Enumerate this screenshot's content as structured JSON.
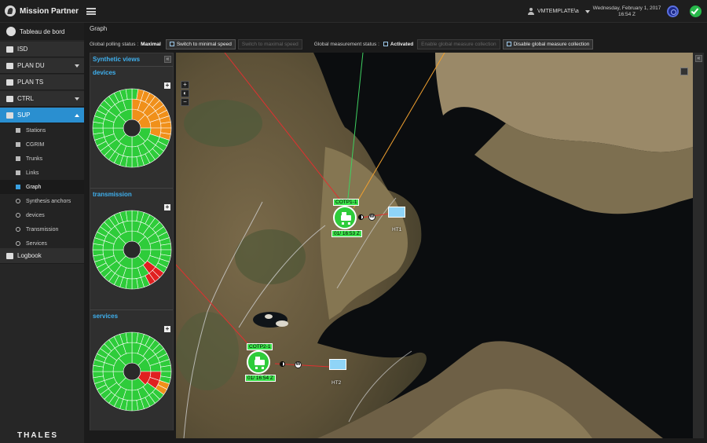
{
  "header": {
    "brand": "Mission Partner",
    "user": "VMTEMPLATE\\a",
    "date": "Wednesday, February 1, 2017",
    "time": "16:54 Z"
  },
  "sidebar": {
    "home": "Tableau de bord",
    "items": [
      {
        "label": "ISD"
      },
      {
        "label": "PLAN DU"
      },
      {
        "label": "PLAN TS"
      },
      {
        "label": "CTRL"
      },
      {
        "label": "SUP"
      }
    ],
    "sub_items": [
      {
        "label": "Stations"
      },
      {
        "label": "CGRIM"
      },
      {
        "label": "Trunks"
      },
      {
        "label": "Links"
      },
      {
        "label": "Graph"
      },
      {
        "label": "Synthesis anchors"
      },
      {
        "label": "devices"
      },
      {
        "label": "Transmission"
      },
      {
        "label": "Services"
      }
    ],
    "logbook": "Logbook",
    "footer": "THALES"
  },
  "breadcrumb": "Graph",
  "toolbar": {
    "polling_label": "Global polling status :",
    "polling_value": "Maximal",
    "btn_min_speed": "Switch to minimal speed",
    "btn_max_speed": "Switch to maximal speed",
    "measure_label": "Global measurement status :",
    "measure_value": "Activated",
    "btn_enable": "Enable global measure collection",
    "btn_disable": "Disable global measure collection"
  },
  "synthetic": {
    "title": "Synthetic views",
    "sections": [
      {
        "title": "devices"
      },
      {
        "title": "transmission"
      },
      {
        "title": "services"
      }
    ]
  },
  "map": {
    "nodes": [
      {
        "label": "COTP1-1",
        "time": "01/ 16:53 Z",
        "flag": "HT1"
      },
      {
        "label": "COTP2-1",
        "time": "01/ 16:54 Z",
        "flag": "HT2"
      }
    ],
    "zoom_in": "+",
    "zoom_out": "−"
  },
  "colors": {
    "accent": "#2a8fd0",
    "ok": "#2ecc3a",
    "warn": "#f0901a",
    "error": "#e02020"
  }
}
